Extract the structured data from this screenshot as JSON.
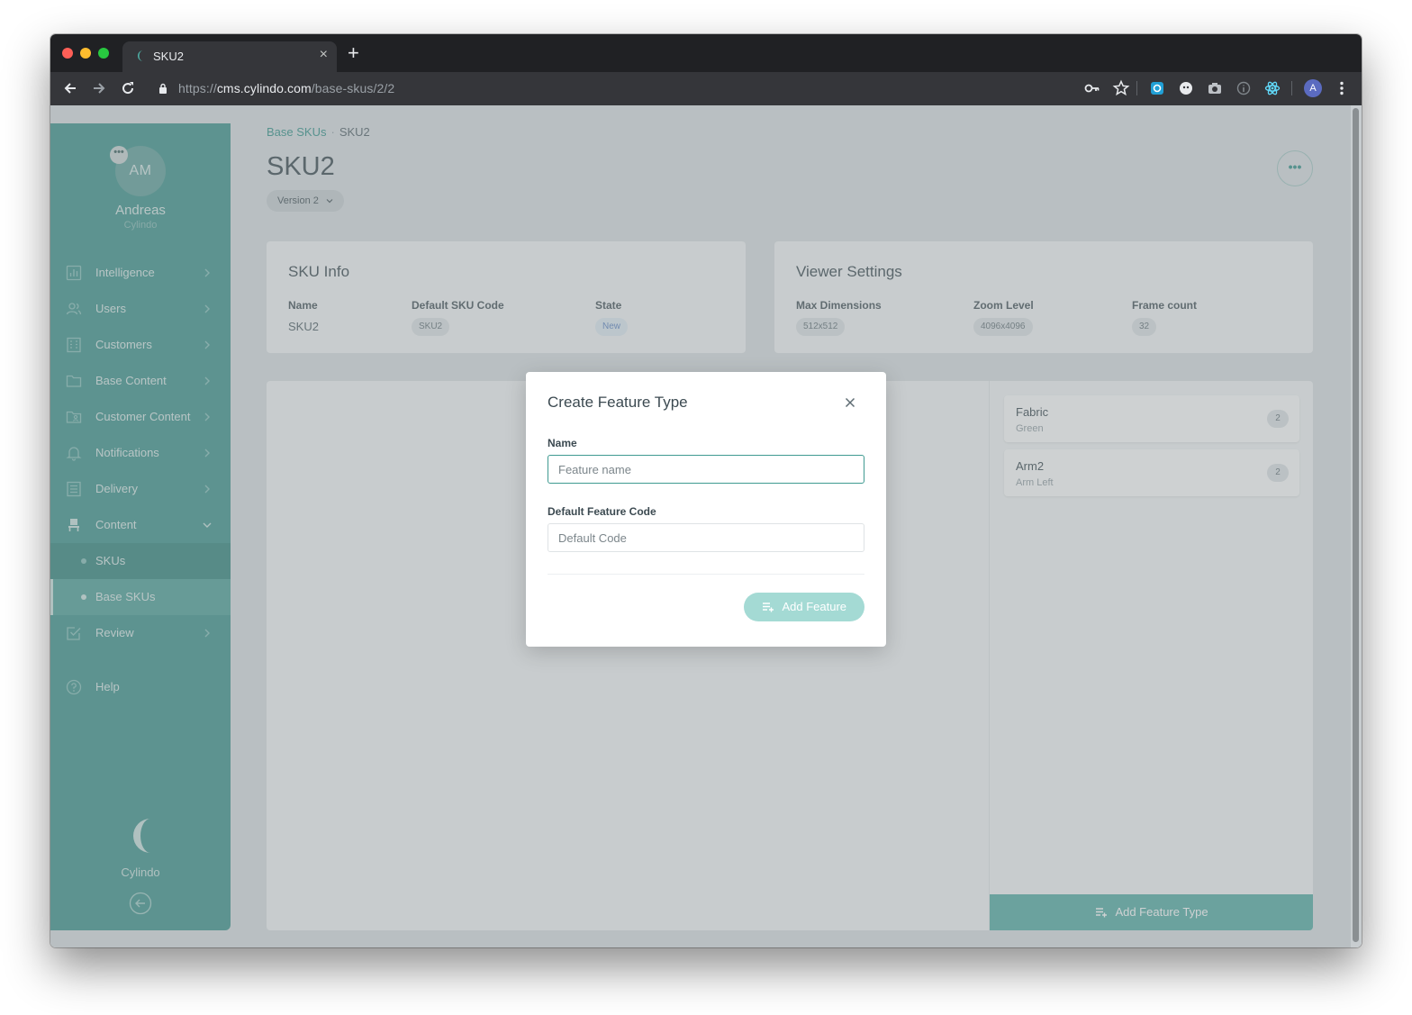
{
  "browser": {
    "tab_title": "SKU2",
    "tab_close": "×",
    "new_tab": "+",
    "url_scheme": "https://",
    "url_host": "cms.cylindo.com",
    "url_path": "/base-skus/2/2",
    "profile_initial": "A"
  },
  "sidebar": {
    "avatar_initials": "AM",
    "avatar_menu": "•••",
    "user_name": "Andreas",
    "user_org": "Cylindo",
    "items": [
      {
        "label": "Intelligence",
        "icon": "bar-chart-icon"
      },
      {
        "label": "Users",
        "icon": "users-icon"
      },
      {
        "label": "Customers",
        "icon": "building-icon"
      },
      {
        "label": "Base Content",
        "icon": "folder-icon"
      },
      {
        "label": "Customer Content",
        "icon": "folder-user-icon"
      },
      {
        "label": "Notifications",
        "icon": "bell-icon"
      },
      {
        "label": "Delivery",
        "icon": "list-icon"
      },
      {
        "label": "Content",
        "icon": "chair-icon"
      },
      {
        "label": "Review",
        "icon": "check-square-icon"
      },
      {
        "label": "Help",
        "icon": "help-icon"
      }
    ],
    "sub_items": [
      {
        "label": "SKUs",
        "active": false
      },
      {
        "label": "Base SKUs",
        "active": true
      }
    ],
    "brand_name": "Cylindo"
  },
  "main": {
    "breadcrumb_parent": "Base SKUs",
    "breadcrumb_sep": "·",
    "breadcrumb_current": "SKU2",
    "page_title": "SKU2",
    "version_label": "Version 2",
    "more_label": "•••"
  },
  "sku_info": {
    "title": "SKU Info",
    "name_label": "Name",
    "name_value": "SKU2",
    "code_label": "Default SKU Code",
    "code_value": "SKU2",
    "state_label": "State",
    "state_value": "New"
  },
  "viewer_settings": {
    "title": "Viewer Settings",
    "dimensions_label": "Max Dimensions",
    "dimensions_value": "512x512",
    "zoom_label": "Zoom Level",
    "zoom_value": "4096x4096",
    "frames_label": "Frame count",
    "frames_value": "32"
  },
  "feature_types": [
    {
      "name": "Fabric",
      "sub": "Green",
      "count": "2"
    },
    {
      "name": "Arm2",
      "sub": "Arm Left",
      "count": "2"
    }
  ],
  "add_feature_type_label": "Add Feature Type",
  "modal": {
    "title": "Create Feature Type",
    "name_label": "Name",
    "name_placeholder": "Feature name",
    "code_label": "Default Feature Code",
    "code_placeholder": "Default Code",
    "submit_label": "Add Feature"
  },
  "colors": {
    "accent": "#4a9c95",
    "accent_light": "#a4dad4",
    "link": "#3f9a91"
  }
}
